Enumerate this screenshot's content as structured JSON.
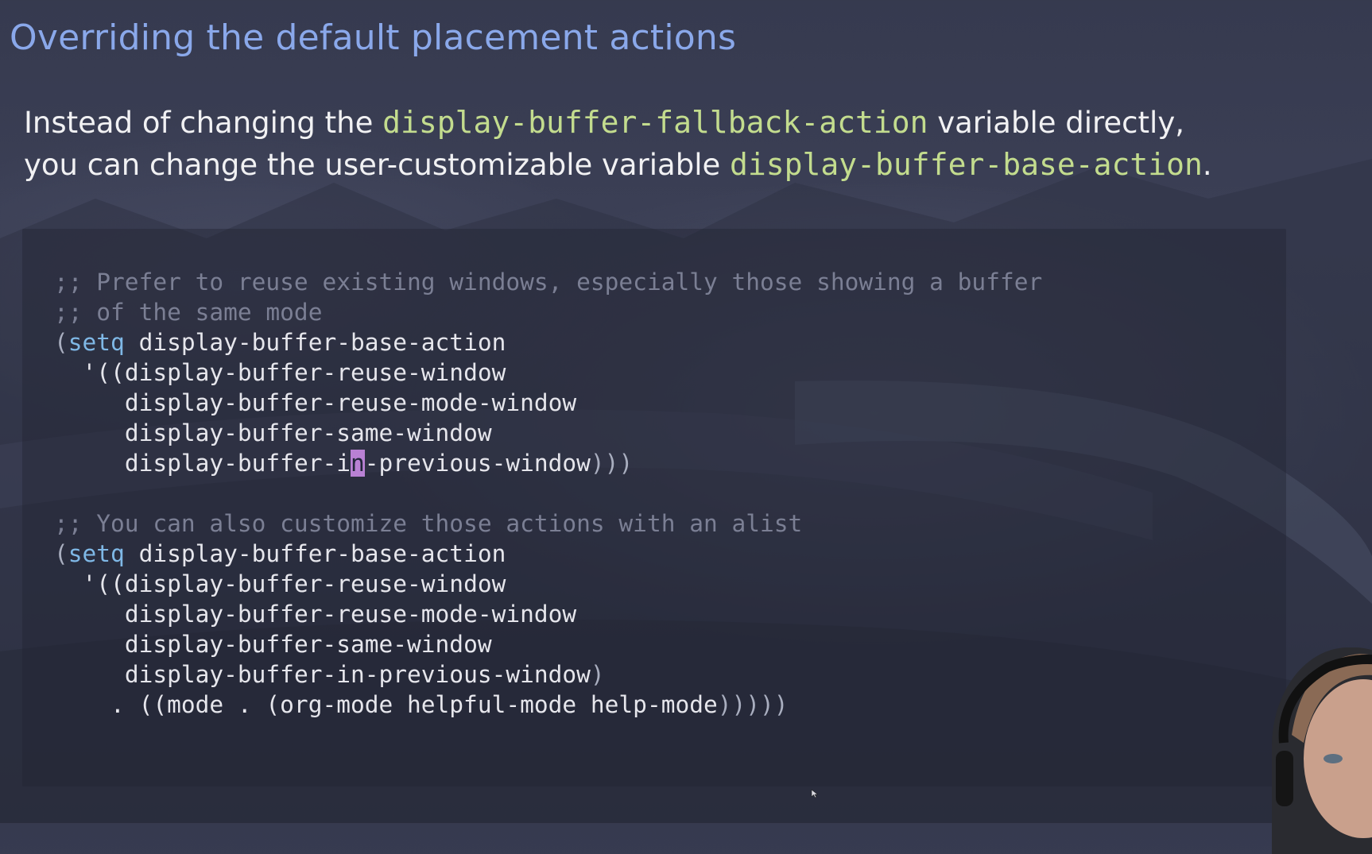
{
  "slide": {
    "title": "Overriding the default placement actions",
    "intro": {
      "part1": "Instead of changing the ",
      "var1": "display-buffer-fallback-action",
      "part2": " variable directly,",
      "part3": "you can change the user-customizable variable ",
      "var2": "display-buffer-base-action",
      "part4": "."
    }
  },
  "code": {
    "block1": {
      "comment1": ";; Prefer to reuse existing windows, especially those showing a buffer",
      "comment2": ";; of the same mode",
      "setq": "setq",
      "var": "display-buffer-base-action",
      "fn1": "display-buffer-reuse-window",
      "fn2": "display-buffer-reuse-mode-window",
      "fn3": "display-buffer-same-window",
      "fn4_before_cursor": "display-buffer-i",
      "cursor_char": "n",
      "fn4_after_cursor": "-previous-window"
    },
    "block2": {
      "comment": ";; You can also customize those actions with an alist",
      "setq": "setq",
      "var": "display-buffer-base-action",
      "fn1": "display-buffer-reuse-window",
      "fn2": "display-buffer-reuse-mode-window",
      "fn3": "display-buffer-same-window",
      "fn4": "display-buffer-in-previous-window",
      "alist": ". ((mode . (org-mode helpful-mode help-mode"
    }
  },
  "colors": {
    "title": "#8aa8ea",
    "variable": "#c3dc8e",
    "comment": "#7b7f94",
    "keyword": "#7fb8e6",
    "cursor": "#b981d4"
  },
  "icons": {
    "pointer": "mouse-pointer-icon"
  }
}
